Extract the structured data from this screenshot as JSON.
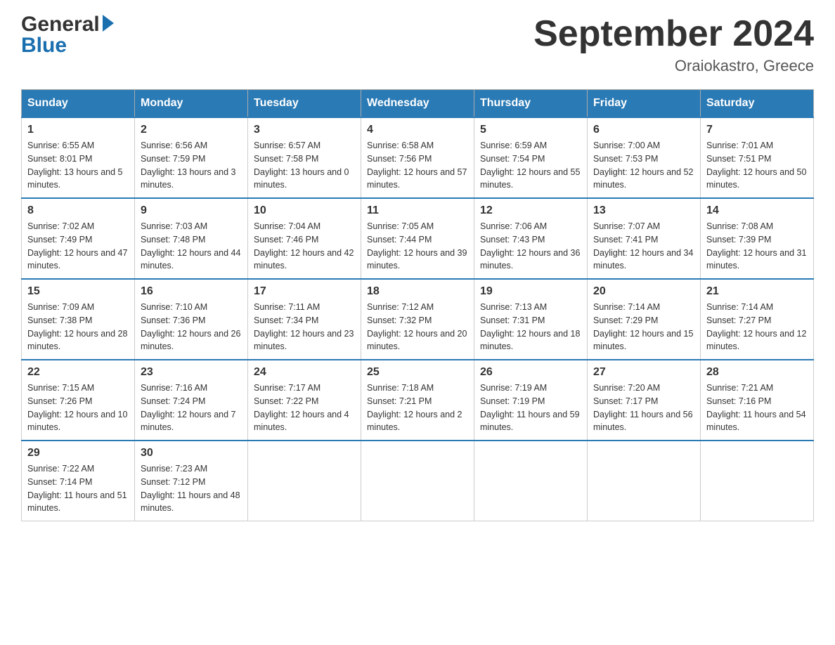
{
  "header": {
    "logo_general": "General",
    "logo_blue": "Blue",
    "month_title": "September 2024",
    "location": "Oraiokastro, Greece"
  },
  "days_of_week": [
    "Sunday",
    "Monday",
    "Tuesday",
    "Wednesday",
    "Thursday",
    "Friday",
    "Saturday"
  ],
  "weeks": [
    [
      {
        "day": "1",
        "sunrise": "Sunrise: 6:55 AM",
        "sunset": "Sunset: 8:01 PM",
        "daylight": "Daylight: 13 hours and 5 minutes."
      },
      {
        "day": "2",
        "sunrise": "Sunrise: 6:56 AM",
        "sunset": "Sunset: 7:59 PM",
        "daylight": "Daylight: 13 hours and 3 minutes."
      },
      {
        "day": "3",
        "sunrise": "Sunrise: 6:57 AM",
        "sunset": "Sunset: 7:58 PM",
        "daylight": "Daylight: 13 hours and 0 minutes."
      },
      {
        "day": "4",
        "sunrise": "Sunrise: 6:58 AM",
        "sunset": "Sunset: 7:56 PM",
        "daylight": "Daylight: 12 hours and 57 minutes."
      },
      {
        "day": "5",
        "sunrise": "Sunrise: 6:59 AM",
        "sunset": "Sunset: 7:54 PM",
        "daylight": "Daylight: 12 hours and 55 minutes."
      },
      {
        "day": "6",
        "sunrise": "Sunrise: 7:00 AM",
        "sunset": "Sunset: 7:53 PM",
        "daylight": "Daylight: 12 hours and 52 minutes."
      },
      {
        "day": "7",
        "sunrise": "Sunrise: 7:01 AM",
        "sunset": "Sunset: 7:51 PM",
        "daylight": "Daylight: 12 hours and 50 minutes."
      }
    ],
    [
      {
        "day": "8",
        "sunrise": "Sunrise: 7:02 AM",
        "sunset": "Sunset: 7:49 PM",
        "daylight": "Daylight: 12 hours and 47 minutes."
      },
      {
        "day": "9",
        "sunrise": "Sunrise: 7:03 AM",
        "sunset": "Sunset: 7:48 PM",
        "daylight": "Daylight: 12 hours and 44 minutes."
      },
      {
        "day": "10",
        "sunrise": "Sunrise: 7:04 AM",
        "sunset": "Sunset: 7:46 PM",
        "daylight": "Daylight: 12 hours and 42 minutes."
      },
      {
        "day": "11",
        "sunrise": "Sunrise: 7:05 AM",
        "sunset": "Sunset: 7:44 PM",
        "daylight": "Daylight: 12 hours and 39 minutes."
      },
      {
        "day": "12",
        "sunrise": "Sunrise: 7:06 AM",
        "sunset": "Sunset: 7:43 PM",
        "daylight": "Daylight: 12 hours and 36 minutes."
      },
      {
        "day": "13",
        "sunrise": "Sunrise: 7:07 AM",
        "sunset": "Sunset: 7:41 PM",
        "daylight": "Daylight: 12 hours and 34 minutes."
      },
      {
        "day": "14",
        "sunrise": "Sunrise: 7:08 AM",
        "sunset": "Sunset: 7:39 PM",
        "daylight": "Daylight: 12 hours and 31 minutes."
      }
    ],
    [
      {
        "day": "15",
        "sunrise": "Sunrise: 7:09 AM",
        "sunset": "Sunset: 7:38 PM",
        "daylight": "Daylight: 12 hours and 28 minutes."
      },
      {
        "day": "16",
        "sunrise": "Sunrise: 7:10 AM",
        "sunset": "Sunset: 7:36 PM",
        "daylight": "Daylight: 12 hours and 26 minutes."
      },
      {
        "day": "17",
        "sunrise": "Sunrise: 7:11 AM",
        "sunset": "Sunset: 7:34 PM",
        "daylight": "Daylight: 12 hours and 23 minutes."
      },
      {
        "day": "18",
        "sunrise": "Sunrise: 7:12 AM",
        "sunset": "Sunset: 7:32 PM",
        "daylight": "Daylight: 12 hours and 20 minutes."
      },
      {
        "day": "19",
        "sunrise": "Sunrise: 7:13 AM",
        "sunset": "Sunset: 7:31 PM",
        "daylight": "Daylight: 12 hours and 18 minutes."
      },
      {
        "day": "20",
        "sunrise": "Sunrise: 7:14 AM",
        "sunset": "Sunset: 7:29 PM",
        "daylight": "Daylight: 12 hours and 15 minutes."
      },
      {
        "day": "21",
        "sunrise": "Sunrise: 7:14 AM",
        "sunset": "Sunset: 7:27 PM",
        "daylight": "Daylight: 12 hours and 12 minutes."
      }
    ],
    [
      {
        "day": "22",
        "sunrise": "Sunrise: 7:15 AM",
        "sunset": "Sunset: 7:26 PM",
        "daylight": "Daylight: 12 hours and 10 minutes."
      },
      {
        "day": "23",
        "sunrise": "Sunrise: 7:16 AM",
        "sunset": "Sunset: 7:24 PM",
        "daylight": "Daylight: 12 hours and 7 minutes."
      },
      {
        "day": "24",
        "sunrise": "Sunrise: 7:17 AM",
        "sunset": "Sunset: 7:22 PM",
        "daylight": "Daylight: 12 hours and 4 minutes."
      },
      {
        "day": "25",
        "sunrise": "Sunrise: 7:18 AM",
        "sunset": "Sunset: 7:21 PM",
        "daylight": "Daylight: 12 hours and 2 minutes."
      },
      {
        "day": "26",
        "sunrise": "Sunrise: 7:19 AM",
        "sunset": "Sunset: 7:19 PM",
        "daylight": "Daylight: 11 hours and 59 minutes."
      },
      {
        "day": "27",
        "sunrise": "Sunrise: 7:20 AM",
        "sunset": "Sunset: 7:17 PM",
        "daylight": "Daylight: 11 hours and 56 minutes."
      },
      {
        "day": "28",
        "sunrise": "Sunrise: 7:21 AM",
        "sunset": "Sunset: 7:16 PM",
        "daylight": "Daylight: 11 hours and 54 minutes."
      }
    ],
    [
      {
        "day": "29",
        "sunrise": "Sunrise: 7:22 AM",
        "sunset": "Sunset: 7:14 PM",
        "daylight": "Daylight: 11 hours and 51 minutes."
      },
      {
        "day": "30",
        "sunrise": "Sunrise: 7:23 AM",
        "sunset": "Sunset: 7:12 PM",
        "daylight": "Daylight: 11 hours and 48 minutes."
      },
      null,
      null,
      null,
      null,
      null
    ]
  ]
}
